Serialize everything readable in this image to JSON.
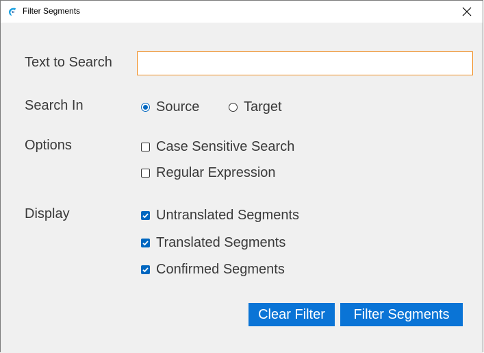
{
  "window": {
    "title": "Filter Segments",
    "app_icon": "app-logo-icon",
    "close_icon": "close-icon"
  },
  "form": {
    "text_to_search": {
      "label": "Text to Search",
      "value": "",
      "placeholder": ""
    },
    "search_in": {
      "label": "Search In",
      "options": [
        {
          "label": "Source",
          "selected": true
        },
        {
          "label": "Target",
          "selected": false
        }
      ]
    },
    "options": {
      "label": "Options",
      "items": [
        {
          "label": "Case Sensitive Search",
          "checked": false
        },
        {
          "label": "Regular Expression",
          "checked": false
        }
      ]
    },
    "display": {
      "label": "Display",
      "items": [
        {
          "label": "Untranslated Segments",
          "checked": true
        },
        {
          "label": "Translated Segments",
          "checked": true
        },
        {
          "label": "Confirmed Segments",
          "checked": true
        }
      ]
    }
  },
  "buttons": {
    "clear_filter": "Clear Filter",
    "filter_segments": "Filter Segments"
  },
  "colors": {
    "accent": "#0067c0",
    "button": "#0a74d6",
    "input_border": "#f08c1e",
    "content_bg": "#f0f0f0"
  }
}
